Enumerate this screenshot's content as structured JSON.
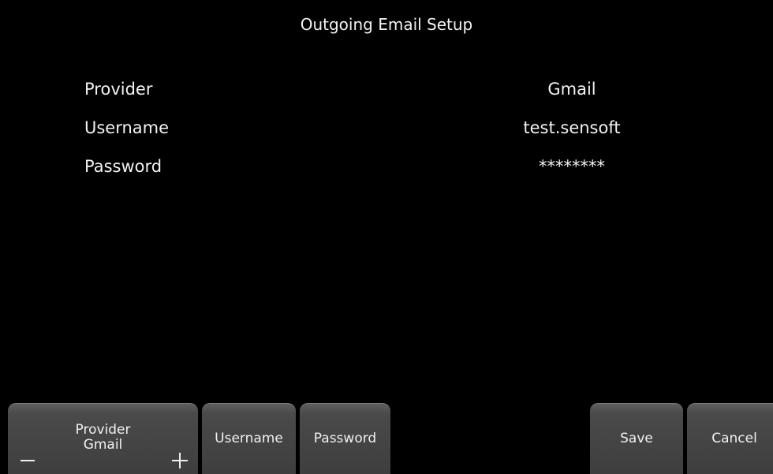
{
  "screen": {
    "title": "Outgoing Email Setup"
  },
  "settings": [
    {
      "label": "Provider",
      "value": "Gmail"
    },
    {
      "label": "Username",
      "value": "test.sensoft"
    },
    {
      "label": "Password",
      "value": "********"
    }
  ],
  "softkeys": {
    "provider": {
      "title": "Provider",
      "value": "Gmail",
      "decrement_icon": "minus-icon",
      "increment_icon": "plus-icon"
    },
    "username": "Username",
    "password": "Password",
    "save": "Save",
    "cancel": "Cancel"
  },
  "colors": {
    "background": "#000000",
    "text": "#f2f2f2",
    "softkey": "#4a4a4a"
  }
}
